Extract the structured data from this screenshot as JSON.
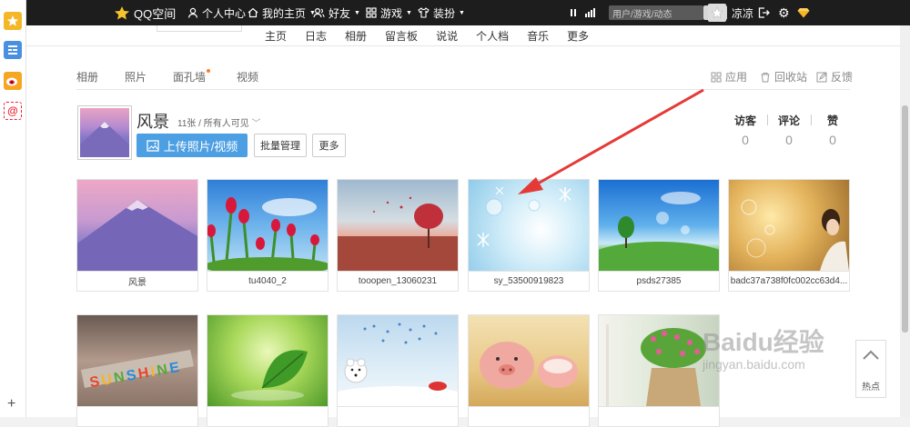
{
  "topbar": {
    "brand": "QQ空间",
    "items": [
      {
        "label": "个人中心",
        "icon": "user-icon"
      },
      {
        "label": "我的主页",
        "icon": "home-icon",
        "dropdown": true
      },
      {
        "label": "好友",
        "icon": "friends-icon",
        "dropdown": true
      },
      {
        "label": "游戏",
        "icon": "grid-icon",
        "dropdown": true
      },
      {
        "label": "装扮",
        "icon": "shirt-icon",
        "dropdown": true
      }
    ],
    "search_placeholder": "用户/游戏/动态",
    "username": "凉凉"
  },
  "nav": [
    "主页",
    "日志",
    "相册",
    "留言板",
    "说说",
    "个人档",
    "音乐",
    "更多"
  ],
  "tabs": [
    "相册",
    "照片",
    "面孔墙",
    "视频"
  ],
  "tools": {
    "apps": "应用",
    "recycle": "回收站",
    "feedback": "反馈"
  },
  "album": {
    "title": "风景",
    "count": "11张",
    "visibility": "/ 所有人可见",
    "upload_label": "上传照片/视频",
    "batch_label": "批量管理",
    "more_label": "更多"
  },
  "stats": [
    {
      "label": "访客",
      "value": "0"
    },
    {
      "label": "评论",
      "value": "0"
    },
    {
      "label": "赞",
      "value": "0"
    }
  ],
  "photos": [
    {
      "caption": "风景"
    },
    {
      "caption": "tu4040_2"
    },
    {
      "caption": "tooopen_13060231"
    },
    {
      "caption": "sy_53500919823"
    },
    {
      "caption": "psds27385"
    },
    {
      "caption": "badc37a738f0fc002cc63d4..."
    },
    {
      "caption": ""
    },
    {
      "caption": ""
    },
    {
      "caption": ""
    },
    {
      "caption": ""
    },
    {
      "caption": ""
    }
  ],
  "hot_label": "热点",
  "watermark": {
    "text": "Baidu经验",
    "url": "jingyan.baidu.com"
  },
  "colors": {
    "accent": "#4d9fe3",
    "topbar": "#1d1d1d",
    "arrow": "#e53935"
  }
}
